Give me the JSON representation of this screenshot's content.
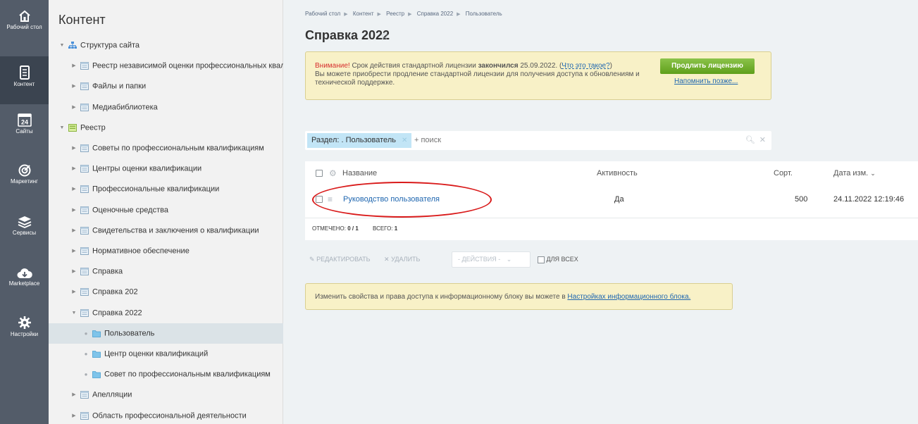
{
  "rail": [
    {
      "label": "Рабочий стол",
      "icon": "home-icon"
    },
    {
      "label": "Контент",
      "icon": "document-icon"
    },
    {
      "label": "Сайты",
      "icon": "calendar-24-icon",
      "badge": "24"
    },
    {
      "label": "Маркетинг",
      "icon": "target-icon"
    },
    {
      "label": "Сервисы",
      "icon": "layers-icon"
    },
    {
      "label": "Marketplace",
      "icon": "cloud-download-icon"
    },
    {
      "label": "Настройки",
      "icon": "gear-icon"
    }
  ],
  "tree": {
    "title": "Контент",
    "items": [
      {
        "label": "Структура сайта",
        "level": 0,
        "expanded": true
      },
      {
        "label": "Реестр независимой оценки профессиональных квалифи",
        "level": 1
      },
      {
        "label": "Файлы и папки",
        "level": 1
      },
      {
        "label": "Медиабиблиотека",
        "level": 1
      },
      {
        "label": "Реестр",
        "level": 0,
        "expanded": true
      },
      {
        "label": "Советы по профессиональным квалификациям",
        "level": 1
      },
      {
        "label": "Центры оценки квалификации",
        "level": 1
      },
      {
        "label": "Профессиональные квалификации",
        "level": 1
      },
      {
        "label": "Оценочные средства",
        "level": 1
      },
      {
        "label": "Свидетельства и заключения о квалификации",
        "level": 1
      },
      {
        "label": "Нормативное обеспечение",
        "level": 1
      },
      {
        "label": "Справка",
        "level": 1
      },
      {
        "label": "Справка 202",
        "level": 1
      },
      {
        "label": "Справка 2022",
        "level": 1,
        "expanded": true
      },
      {
        "label": "Пользователь",
        "level": 2,
        "selected": true
      },
      {
        "label": "Центр оценки квалификаций",
        "level": 2
      },
      {
        "label": "Совет по профессиональным квалификациям",
        "level": 2
      },
      {
        "label": "Апелляции",
        "level": 1
      },
      {
        "label": "Область профессиональной деятельности",
        "level": 1
      }
    ]
  },
  "breadcrumbs": [
    "Рабочий стол",
    "Контент",
    "Реестр",
    "Справка 2022",
    "Пользователь"
  ],
  "page_title": "Справка 2022",
  "license": {
    "warn": "Внимание!",
    "text1": " Срок действия стандартной лицензии ",
    "bold": "закончился",
    "text2": " 25.09.2022. (",
    "link": "Что это такое?",
    "text3": ")",
    "line2": "Вы можете приобрести продление стандартной лицензии для получения доступа к обновлениям и технической поддержке.",
    "renew_button": "Продлить лицензию",
    "remind_link": "Напомнить позже..."
  },
  "filter": {
    "chip": "Раздел: . Пользователь",
    "placeholder": "+ поиск"
  },
  "grid": {
    "columns": {
      "name": "Название",
      "active": "Активность",
      "sort": "Сорт.",
      "date": "Дата изм."
    },
    "rows": [
      {
        "name": "Руководство пользователя",
        "active": "Да",
        "sort": "500",
        "date": "24.11.2022 12:19:46"
      }
    ],
    "marked_label": "ОТМЕЧЕНО:",
    "marked_value": "0 / 1",
    "total_label": "ВСЕГО:",
    "total_value": "1"
  },
  "actions": {
    "edit": "РЕДАКТИРОВАТЬ",
    "delete": "УДАЛИТЬ",
    "select": "- ДЕЙСТВИЯ -",
    "for_all": "ДЛЯ ВСЕХ"
  },
  "info": {
    "text": "Изменить свойства и права доступа к информационному блоку вы можете в ",
    "link": "Настройках информационного блока."
  },
  "colors": {
    "accent_green": "#5f9f1b",
    "link": "#2067b0",
    "rail": "#535c69",
    "annotation": "#d91a1a"
  }
}
